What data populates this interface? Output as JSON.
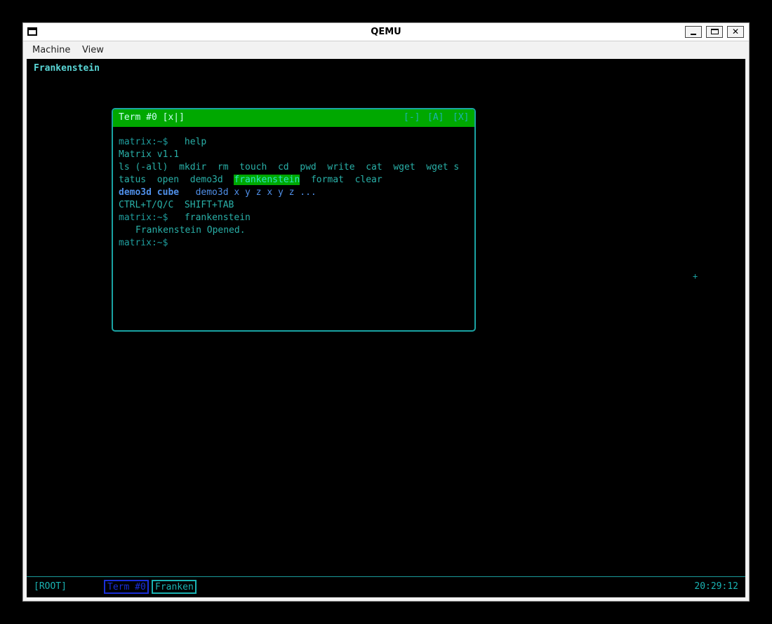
{
  "window": {
    "title": "QEMU",
    "buttons": {
      "minimize": "minimize",
      "maximize": "maximize",
      "close": "✕"
    }
  },
  "menubar": {
    "items": [
      "Machine",
      "View"
    ]
  },
  "desktop": {
    "top_label": "Frankenstein",
    "crosshair": "+"
  },
  "terminal": {
    "title": "Term #0 [x|]",
    "controls": {
      "minimize": "[-]",
      "maximize": "[A]",
      "close": "[X]"
    },
    "lines": {
      "l1_prompt": "matrix:~$",
      "l1_cmd": "   help",
      "l2": "Matrix v1.1",
      "l3": "ls (-all)  mkdir  rm  touch  cd  pwd  write  cat  wget  wget s",
      "l4_a": "tatus  open  demo3d  ",
      "l4_hl": "frankenstein",
      "l4_b": "  format  clear",
      "l5_a": "demo3d cube",
      "l5_b": "   demo3d x y z x y z ...",
      "l6": "CTRL+T/Q/C  SHIFT+TAB",
      "l7_prompt": "matrix:~$",
      "l7_cmd": "   frankenstein",
      "l8": "Frankenstein Opened.",
      "l9_prompt": "matrix:~$"
    }
  },
  "taskbar": {
    "root": "[ROOT]",
    "tasks": [
      "Term #0",
      "Franken"
    ],
    "clock": "20:29:12"
  },
  "colors": {
    "header_green": "#00a800",
    "cyan": "#1ab3b3",
    "blue": "#1a2fd8"
  }
}
